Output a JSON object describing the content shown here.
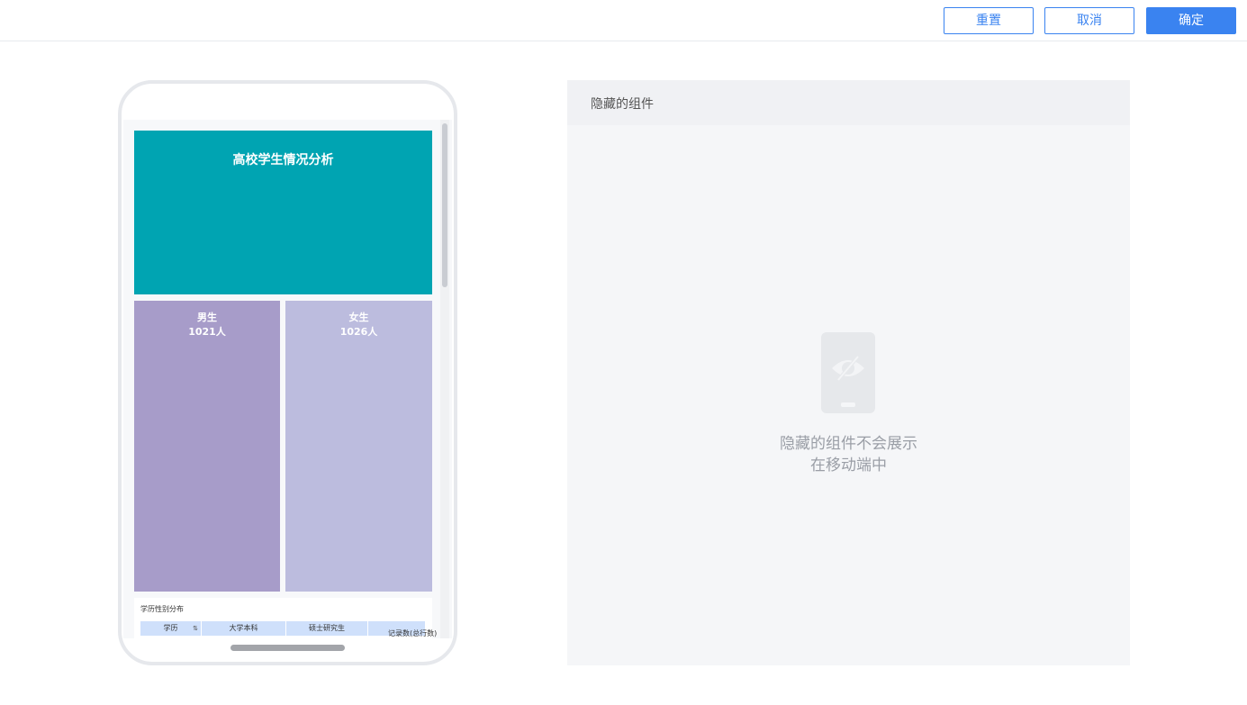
{
  "toolbar": {
    "reset_label": "重置",
    "cancel_label": "取消",
    "confirm_label": "确定"
  },
  "preview": {
    "title": "高校学生情况分析",
    "male": {
      "label": "男生",
      "value": "1021人"
    },
    "female": {
      "label": "女生",
      "value": "1026人"
    },
    "table": {
      "title": "学历性别分布",
      "columns": [
        "学历",
        "大学本科",
        "硕士研究生"
      ],
      "extra_header": "记录数(总行数)"
    }
  },
  "hidden_panel": {
    "title": "隐藏的组件",
    "empty_line1": "隐藏的组件不会展示",
    "empty_line2": "在移动端中"
  },
  "colors": {
    "primary": "#3a83f0",
    "title_block": "#00a4b2",
    "male_block": "#a79cc9",
    "female_block": "#bcbcde"
  },
  "icons": {
    "empty_state": "hidden-phone-icon",
    "sort": "sort-icon"
  }
}
